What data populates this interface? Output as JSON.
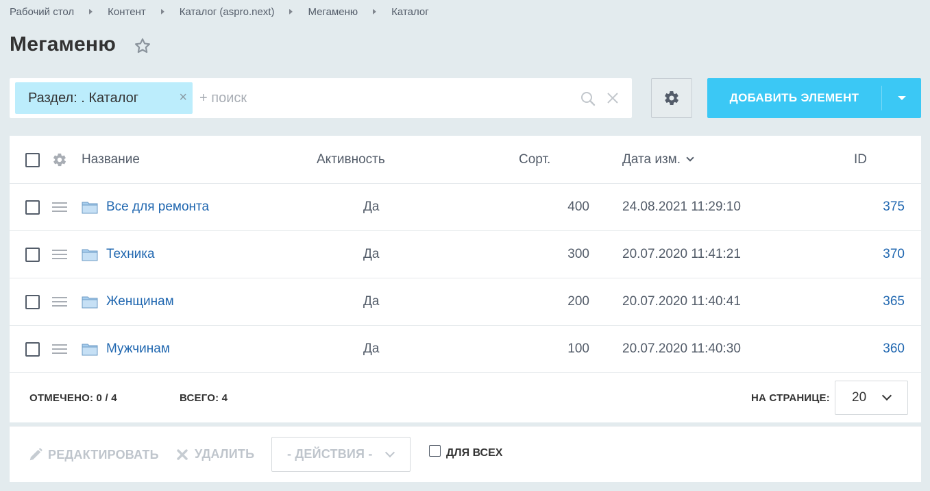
{
  "breadcrumb": [
    "Рабочий стол",
    "Контент",
    "Каталог (aspro.next)",
    "Мегаменю",
    "Каталог"
  ],
  "page": {
    "title": "Мегаменю"
  },
  "filter": {
    "tag_label": "Раздел: . Каталог",
    "tag_close": "×",
    "search_placeholder": "+ поиск",
    "search_value": ""
  },
  "toolbar": {
    "add_label": "ДОБАВИТЬ ЭЛЕМЕНТ"
  },
  "grid": {
    "columns": {
      "name": "Название",
      "active": "Активность",
      "sort": "Сорт.",
      "date": "Дата изм.",
      "id": "ID"
    },
    "rows": [
      {
        "name": "Все для ремонта",
        "active": "Да",
        "sort": "400",
        "date": "24.08.2021 11:29:10",
        "id": "375"
      },
      {
        "name": "Техника",
        "active": "Да",
        "sort": "300",
        "date": "20.07.2020 11:41:21",
        "id": "370"
      },
      {
        "name": "Женщинам",
        "active": "Да",
        "sort": "200",
        "date": "20.07.2020 11:40:41",
        "id": "365"
      },
      {
        "name": "Мужчинам",
        "active": "Да",
        "sort": "100",
        "date": "20.07.2020 11:40:30",
        "id": "360"
      }
    ],
    "footer": {
      "selected_label": "ОТМЕЧЕНО:",
      "selected_value": "0 / 4",
      "total_label": "ВСЕГО:",
      "total_value": "4",
      "per_page_label": "НА СТРАНИЦЕ:",
      "per_page_value": "20"
    }
  },
  "actions": {
    "edit_label": "РЕДАКТИРОВАТЬ",
    "delete_label": "УДАЛИТЬ",
    "actions_select": "- ДЕЙСТВИЯ -",
    "for_all_label": "ДЛЯ ВСЕХ"
  },
  "colors": {
    "background": "#e3ebee",
    "accent": "#3bc8f5",
    "link": "#2067b0",
    "tag_bg": "#bcedfc"
  },
  "icons": [
    "star-icon",
    "search-icon",
    "clear-icon",
    "gear-icon",
    "drag-handle-icon",
    "folder-icon",
    "chevron-down-icon",
    "pencil-icon",
    "cross-icon"
  ]
}
